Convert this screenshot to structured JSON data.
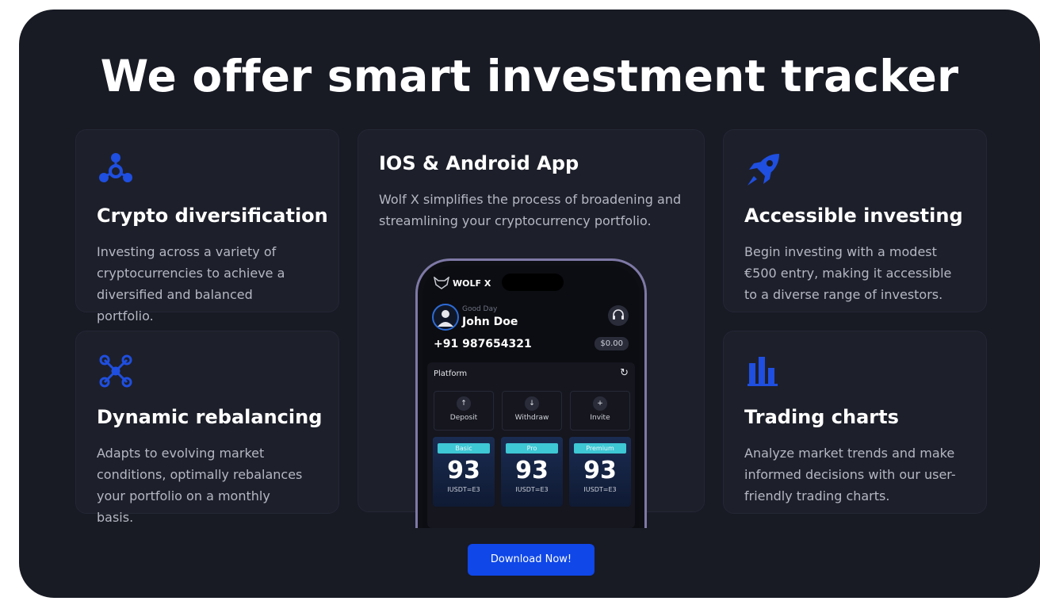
{
  "headline": "We offer smart investment tracker",
  "cards": {
    "crypto": {
      "title": "Crypto diversification",
      "desc": "Investing across a variety of cryptocurrencies to achieve a diversified and balanced portfolio.",
      "icon": "network-icon"
    },
    "rebalance": {
      "title": "Dynamic rebalancing",
      "desc": "Adapts to evolving market conditions, optimally rebalances your portfolio on a monthly basis.",
      "icon": "nodes-icon"
    },
    "investing": {
      "title": "Accessible investing",
      "desc": "Begin investing with a modest €500 entry, making it accessible to a diverse range of investors.",
      "icon": "rocket-icon"
    },
    "charts": {
      "title": "Trading charts",
      "desc": "Analyze market trends and make informed decisions with our user-friendly trading charts.",
      "icon": "bar-chart-icon"
    }
  },
  "app": {
    "title": "IOS & Android App",
    "desc": "Wolf X simplifies the process of broadening and streamlining your cryptocurrency portfolio."
  },
  "phone": {
    "brand": "WOLF X",
    "greeting": "Good Day",
    "name": "John Doe",
    "phone": "+91  987654321",
    "balance": "$0.00",
    "platform": "Platform",
    "actions": [
      "Deposit",
      "Withdraw",
      "Invite"
    ],
    "plans": [
      {
        "tag": "Basic",
        "value": "93",
        "sub": "IUSDT=E3"
      },
      {
        "tag": "Pro",
        "value": "93",
        "sub": "IUSDT=E3"
      },
      {
        "tag": "Premium",
        "value": "93",
        "sub": "IUSDT=E3"
      }
    ]
  },
  "cta": "Download Now!",
  "colors": {
    "accent": "#0f47e8",
    "icon": "#1f4fe0",
    "background": "#181a24",
    "card": "#1d1f2a"
  }
}
